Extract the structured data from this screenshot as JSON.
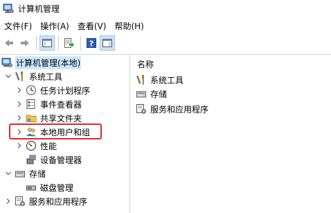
{
  "window": {
    "title": "计算机管理"
  },
  "menu": [
    {
      "label": "文件(F)"
    },
    {
      "label": "操作(A)"
    },
    {
      "label": "查看(V)"
    },
    {
      "label": "帮助(H)"
    }
  ],
  "toolbar": {
    "icons": [
      "back-arrow-icon",
      "forward-arrow-icon",
      "show-hide-tree-icon",
      "export-list-icon",
      "help-icon",
      "properties-pane-icon"
    ]
  },
  "tree": {
    "root": {
      "label": "计算机管理(本地)"
    },
    "system_tools": {
      "label": "系统工具"
    },
    "task_scheduler": {
      "label": "任务计划程序"
    },
    "event_viewer": {
      "label": "事件查看器"
    },
    "shared_folders": {
      "label": "共享文件夹"
    },
    "local_users": {
      "label": "本地用户和组"
    },
    "performance": {
      "label": "性能"
    },
    "device_manager": {
      "label": "设备管理器"
    },
    "storage": {
      "label": "存储"
    },
    "disk_management": {
      "label": "磁盘管理"
    },
    "services_apps": {
      "label": "服务和应用程序"
    }
  },
  "content": {
    "column_header": "名称",
    "items": [
      {
        "label": "系统工具",
        "icon": "system-tools-icon"
      },
      {
        "label": "存储",
        "icon": "storage-icon"
      },
      {
        "label": "服务和应用程序",
        "icon": "services-apps-icon"
      }
    ]
  },
  "colors": {
    "highlight": "#e0262b",
    "selection": "#cce8ff"
  }
}
